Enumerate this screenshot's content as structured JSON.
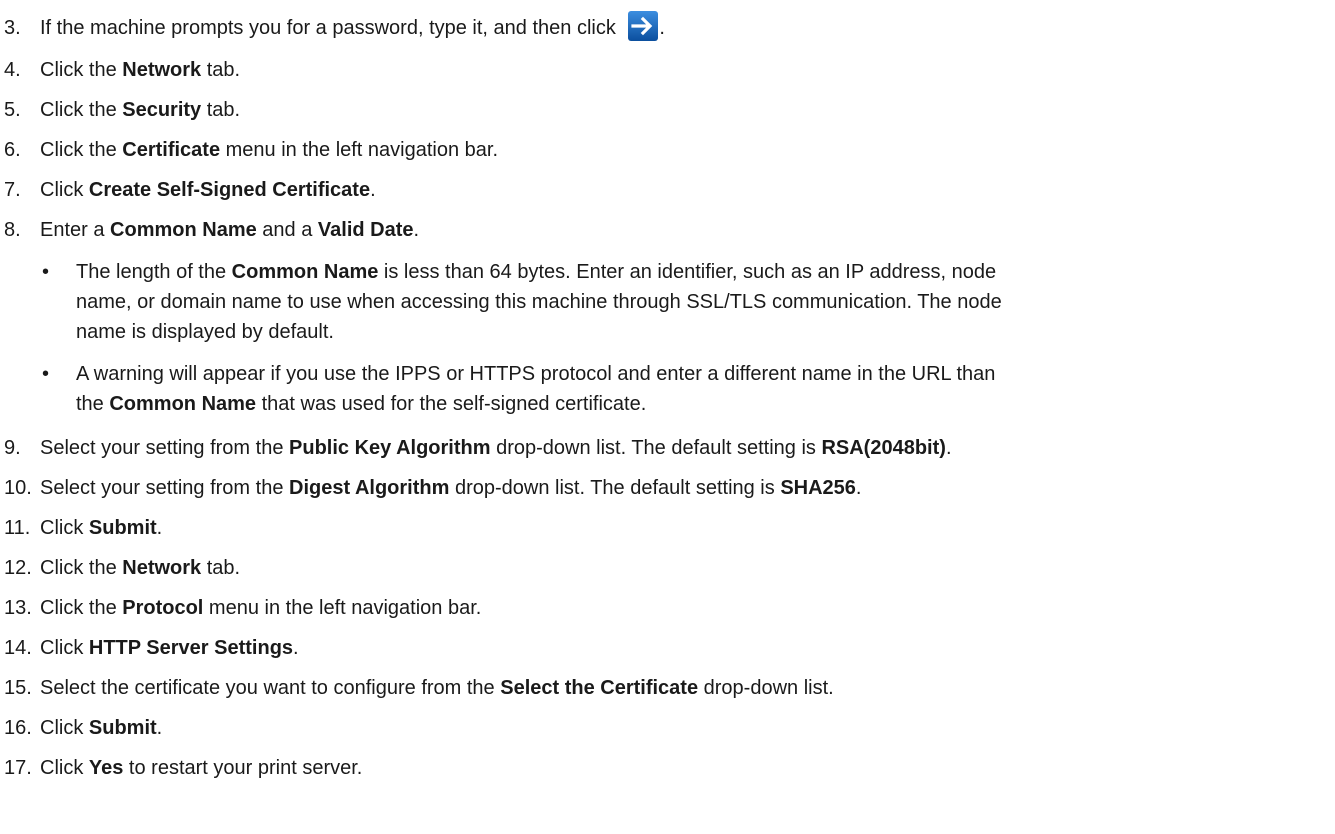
{
  "steps": [
    {
      "num": "3.",
      "parts": [
        "If the machine prompts you for a password, type it, and then click ",
        "."
      ],
      "icon": "right-arrow-icon"
    },
    {
      "num": "4.",
      "pre": "Click the ",
      "bold": "Network",
      "post": " tab."
    },
    {
      "num": "5.",
      "pre": "Click the ",
      "bold": "Security",
      "post": " tab."
    },
    {
      "num": "6.",
      "pre": "Click the ",
      "bold": "Certificate",
      "post": " menu in the left navigation bar."
    },
    {
      "num": "7.",
      "pre": "Click ",
      "bold": "Create Self-Signed Certificate",
      "post": "."
    },
    {
      "num": "8.",
      "pre": "Enter a ",
      "bold": "Common Name",
      "mid": " and a ",
      "bold2": "Valid Date",
      "post": "."
    },
    {
      "num": "9.",
      "pre": "Select your setting from the ",
      "bold": "Public Key Algorithm",
      "mid": " drop-down list. The default setting is ",
      "bold2": "RSA(2048bit)",
      "post": "."
    },
    {
      "num": "10.",
      "pre": "Select your setting from the ",
      "bold": "Digest Algorithm",
      "mid": " drop-down list. The default setting is ",
      "bold2": "SHA256",
      "post": "."
    },
    {
      "num": "11.",
      "pre": "Click ",
      "bold": "Submit",
      "post": "."
    },
    {
      "num": "12.",
      "pre": "Click the ",
      "bold": "Network",
      "post": " tab."
    },
    {
      "num": "13.",
      "pre": "Click the ",
      "bold": "Protocol",
      "post": " menu in the left navigation bar."
    },
    {
      "num": "14.",
      "pre": "Click ",
      "bold": "HTTP Server Settings",
      "post": "."
    },
    {
      "num": "15.",
      "pre": "Select the certificate you want to configure from the ",
      "bold": "Select the Certificate",
      "post": " drop-down list."
    },
    {
      "num": "16.",
      "pre": "Click ",
      "bold": "Submit",
      "post": "."
    },
    {
      "num": "17.",
      "pre": "Click ",
      "bold": "Yes",
      "post": " to restart your print server."
    }
  ],
  "bullets": [
    {
      "symbol": "•",
      "l1_pre": "The length of the ",
      "l1_bold": "Common Name",
      "l1_post": " is less than 64 bytes. Enter an identifier, such as an IP address, node",
      "l2": "name, or domain name to use when accessing this machine through SSL/TLS communication. The node",
      "l3": "name is displayed by default."
    },
    {
      "symbol": "•",
      "l1": "A warning will appear if you use the IPPS or HTTPS protocol and enter a different name in the URL than",
      "l2_pre": "the ",
      "l2_bold": "Common Name",
      "l2_post": " that was used for the self-signed certificate."
    }
  ],
  "colors": {
    "text": "#1a1a1a",
    "arrow_button_bg": "#1f6fc4",
    "arrow_button_edge": "#0b4f9e",
    "arrow_glyph": "#ffffff"
  }
}
